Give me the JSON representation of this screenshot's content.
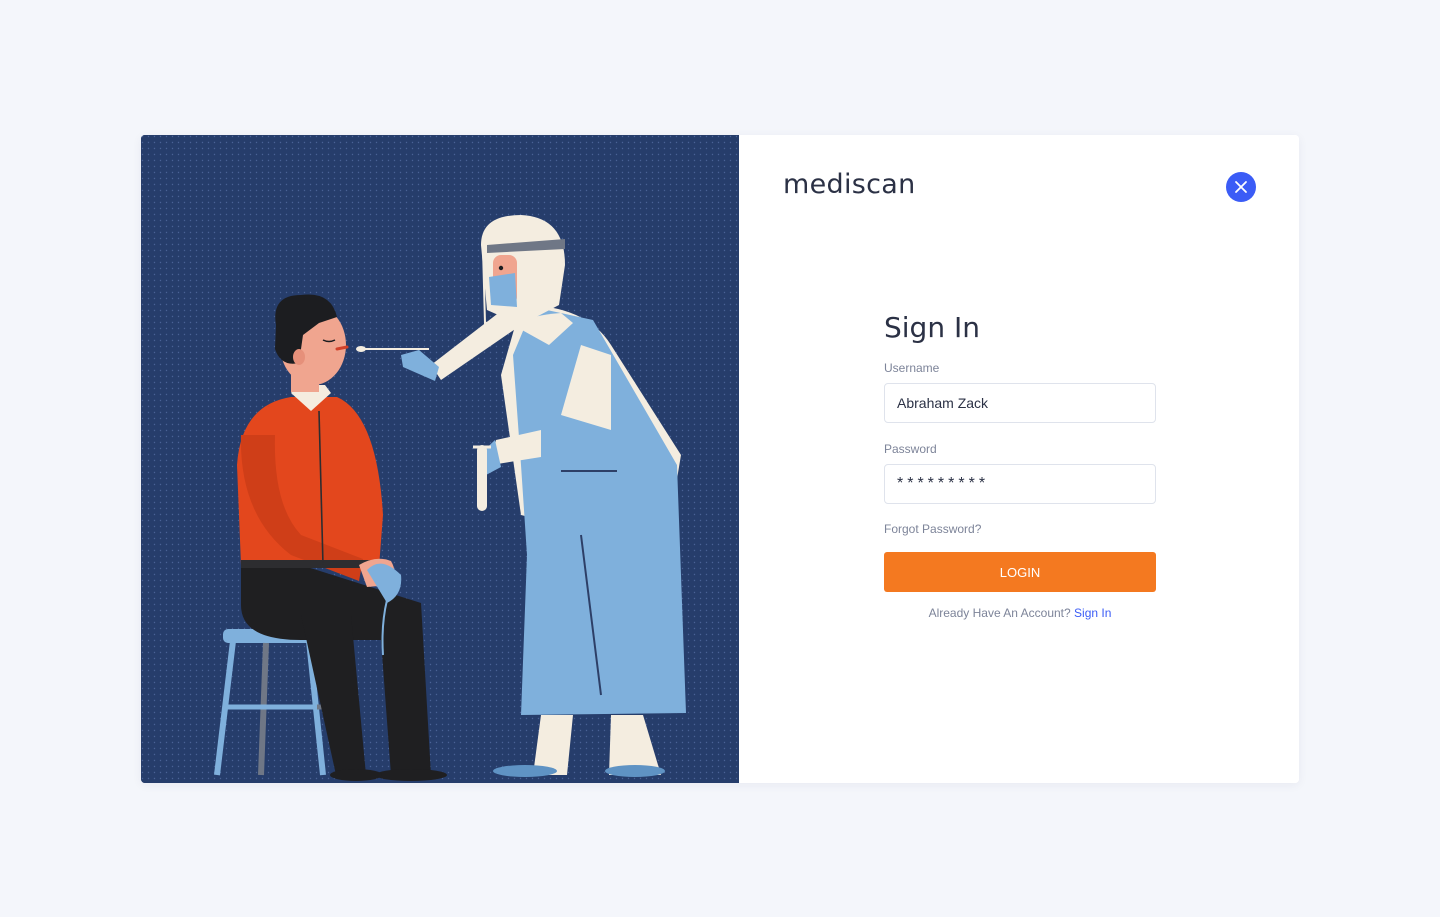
{
  "brand": {
    "name": "mediscan"
  },
  "close": {
    "icon": "close-icon"
  },
  "form": {
    "title": "Sign In",
    "username_label": "Username",
    "username_value": "Abraham Zack",
    "password_label": "Password",
    "password_value": "*********",
    "forgot_label": "Forgot Password?",
    "login_label": "LOGIN",
    "account_prompt": "Already Have An Account?",
    "signin_link": "Sign In"
  },
  "colors": {
    "accent": "#f47920",
    "primary": "#3b5cf6",
    "illustration_background": "#263d6b"
  }
}
